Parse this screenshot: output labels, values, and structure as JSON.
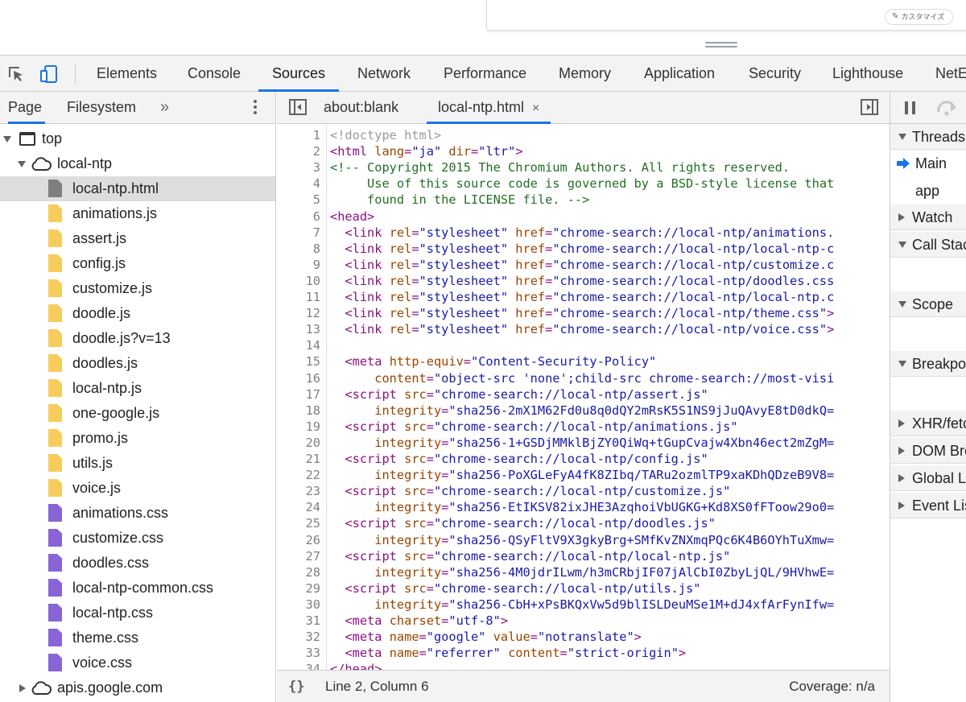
{
  "page": {
    "customize_label": "カスタマイズ"
  },
  "devtools_tabs": [
    "Elements",
    "Console",
    "Sources",
    "Network",
    "Performance",
    "Memory",
    "Application",
    "Security",
    "Lighthouse",
    "NetE"
  ],
  "active_tab": "Sources",
  "navigator": {
    "tabs": [
      "Page",
      "Filesystem"
    ],
    "more": "»",
    "tree": {
      "top": "top",
      "origin": "local-ntp",
      "files": [
        {
          "name": "local-ntp.html",
          "type": "html",
          "selected": true
        },
        {
          "name": "animations.js",
          "type": "js"
        },
        {
          "name": "assert.js",
          "type": "js"
        },
        {
          "name": "config.js",
          "type": "js"
        },
        {
          "name": "customize.js",
          "type": "js"
        },
        {
          "name": "doodle.js",
          "type": "js"
        },
        {
          "name": "doodle.js?v=13",
          "type": "js"
        },
        {
          "name": "doodles.js",
          "type": "js"
        },
        {
          "name": "local-ntp.js",
          "type": "js"
        },
        {
          "name": "one-google.js",
          "type": "js"
        },
        {
          "name": "promo.js",
          "type": "js"
        },
        {
          "name": "utils.js",
          "type": "js"
        },
        {
          "name": "voice.js",
          "type": "js"
        },
        {
          "name": "animations.css",
          "type": "css"
        },
        {
          "name": "customize.css",
          "type": "css"
        },
        {
          "name": "doodles.css",
          "type": "css"
        },
        {
          "name": "local-ntp-common.css",
          "type": "css"
        },
        {
          "name": "local-ntp.css",
          "type": "css"
        },
        {
          "name": "theme.css",
          "type": "css"
        },
        {
          "name": "voice.css",
          "type": "css"
        }
      ],
      "other_origin": "apis.google.com"
    }
  },
  "editor": {
    "tabs": [
      {
        "label": "about:blank",
        "active": false,
        "closable": false
      },
      {
        "label": "local-ntp.html",
        "active": true,
        "closable": true
      }
    ],
    "close_glyph": "×",
    "lines": [
      [
        [
          "doctype",
          "<!doctype html>"
        ]
      ],
      [
        [
          "tag",
          "<html "
        ],
        [
          "attr",
          "lang"
        ],
        [
          "tag",
          "="
        ],
        [
          "val",
          "\"ja\""
        ],
        [
          "tag",
          " "
        ],
        [
          "attr",
          "dir"
        ],
        [
          "tag",
          "="
        ],
        [
          "val",
          "\"ltr\""
        ],
        [
          "tag",
          ">"
        ]
      ],
      [
        [
          "comment",
          "<!-- Copyright 2015 The Chromium Authors. All rights reserved."
        ]
      ],
      [
        [
          "comment",
          "     Use of this source code is governed by a BSD-style license that"
        ]
      ],
      [
        [
          "comment",
          "     found in the LICENSE file. -->"
        ]
      ],
      [
        [
          "tag",
          "<head>"
        ]
      ],
      [
        [
          "tag",
          "  <link "
        ],
        [
          "attr",
          "rel"
        ],
        [
          "tag",
          "="
        ],
        [
          "val",
          "\"stylesheet\""
        ],
        [
          "tag",
          " "
        ],
        [
          "attr",
          "href"
        ],
        [
          "tag",
          "="
        ],
        [
          "val",
          "\"chrome-search://local-ntp/animations."
        ]
      ],
      [
        [
          "tag",
          "  <link "
        ],
        [
          "attr",
          "rel"
        ],
        [
          "tag",
          "="
        ],
        [
          "val",
          "\"stylesheet\""
        ],
        [
          "tag",
          " "
        ],
        [
          "attr",
          "href"
        ],
        [
          "tag",
          "="
        ],
        [
          "val",
          "\"chrome-search://local-ntp/local-ntp-c"
        ]
      ],
      [
        [
          "tag",
          "  <link "
        ],
        [
          "attr",
          "rel"
        ],
        [
          "tag",
          "="
        ],
        [
          "val",
          "\"stylesheet\""
        ],
        [
          "tag",
          " "
        ],
        [
          "attr",
          "href"
        ],
        [
          "tag",
          "="
        ],
        [
          "val",
          "\"chrome-search://local-ntp/customize.c"
        ]
      ],
      [
        [
          "tag",
          "  <link "
        ],
        [
          "attr",
          "rel"
        ],
        [
          "tag",
          "="
        ],
        [
          "val",
          "\"stylesheet\""
        ],
        [
          "tag",
          " "
        ],
        [
          "attr",
          "href"
        ],
        [
          "tag",
          "="
        ],
        [
          "val",
          "\"chrome-search://local-ntp/doodles.css"
        ]
      ],
      [
        [
          "tag",
          "  <link "
        ],
        [
          "attr",
          "rel"
        ],
        [
          "tag",
          "="
        ],
        [
          "val",
          "\"stylesheet\""
        ],
        [
          "tag",
          " "
        ],
        [
          "attr",
          "href"
        ],
        [
          "tag",
          "="
        ],
        [
          "val",
          "\"chrome-search://local-ntp/local-ntp.c"
        ]
      ],
      [
        [
          "tag",
          "  <link "
        ],
        [
          "attr",
          "rel"
        ],
        [
          "tag",
          "="
        ],
        [
          "val",
          "\"stylesheet\""
        ],
        [
          "tag",
          " "
        ],
        [
          "attr",
          "href"
        ],
        [
          "tag",
          "="
        ],
        [
          "val",
          "\"chrome-search://local-ntp/theme.css\""
        ],
        [
          "tag",
          ">"
        ]
      ],
      [
        [
          "tag",
          "  <link "
        ],
        [
          "attr",
          "rel"
        ],
        [
          "tag",
          "="
        ],
        [
          "val",
          "\"stylesheet\""
        ],
        [
          "tag",
          " "
        ],
        [
          "attr",
          "href"
        ],
        [
          "tag",
          "="
        ],
        [
          "val",
          "\"chrome-search://local-ntp/voice.css\""
        ],
        [
          "tag",
          ">"
        ]
      ],
      [],
      [
        [
          "tag",
          "  <meta "
        ],
        [
          "attr",
          "http-equiv"
        ],
        [
          "tag",
          "="
        ],
        [
          "val",
          "\"Content-Security-Policy\""
        ]
      ],
      [
        [
          "tag",
          "      "
        ],
        [
          "attr",
          "content"
        ],
        [
          "tag",
          "="
        ],
        [
          "val",
          "\"object-src 'none';child-src chrome-search://most-visi"
        ]
      ],
      [
        [
          "tag",
          "  <script "
        ],
        [
          "attr",
          "src"
        ],
        [
          "tag",
          "="
        ],
        [
          "val",
          "\"chrome-search://local-ntp/assert.js\""
        ]
      ],
      [
        [
          "tag",
          "      "
        ],
        [
          "attr",
          "integrity"
        ],
        [
          "tag",
          "="
        ],
        [
          "val",
          "\"sha256-2mX1M62Fd0u8q0dQY2mRsK5S1NS9jJuQAvyE8tD0dkQ="
        ]
      ],
      [
        [
          "tag",
          "  <script "
        ],
        [
          "attr",
          "src"
        ],
        [
          "tag",
          "="
        ],
        [
          "val",
          "\"chrome-search://local-ntp/animations.js\""
        ]
      ],
      [
        [
          "tag",
          "      "
        ],
        [
          "attr",
          "integrity"
        ],
        [
          "tag",
          "="
        ],
        [
          "val",
          "\"sha256-1+GSDjMMklBjZY0QiWq+tGupCvajw4Xbn46ect2mZgM="
        ]
      ],
      [
        [
          "tag",
          "  <script "
        ],
        [
          "attr",
          "src"
        ],
        [
          "tag",
          "="
        ],
        [
          "val",
          "\"chrome-search://local-ntp/config.js\""
        ]
      ],
      [
        [
          "tag",
          "      "
        ],
        [
          "attr",
          "integrity"
        ],
        [
          "tag",
          "="
        ],
        [
          "val",
          "\"sha256-PoXGLeFyA4fK8ZIbq/TARu2ozmlTP9xaKDhQDzeB9V8="
        ]
      ],
      [
        [
          "tag",
          "  <script "
        ],
        [
          "attr",
          "src"
        ],
        [
          "tag",
          "="
        ],
        [
          "val",
          "\"chrome-search://local-ntp/customize.js\""
        ]
      ],
      [
        [
          "tag",
          "      "
        ],
        [
          "attr",
          "integrity"
        ],
        [
          "tag",
          "="
        ],
        [
          "val",
          "\"sha256-EtIKSV82ixJHE3AzqhoiVbUGKG+Kd8XS0fFToow29o0="
        ]
      ],
      [
        [
          "tag",
          "  <script "
        ],
        [
          "attr",
          "src"
        ],
        [
          "tag",
          "="
        ],
        [
          "val",
          "\"chrome-search://local-ntp/doodles.js\""
        ]
      ],
      [
        [
          "tag",
          "      "
        ],
        [
          "attr",
          "integrity"
        ],
        [
          "tag",
          "="
        ],
        [
          "val",
          "\"sha256-QSyFltV9X3gkyBrg+SMfKvZNXmqPQc6K4B6OYhTuXmw="
        ]
      ],
      [
        [
          "tag",
          "  <script "
        ],
        [
          "attr",
          "src"
        ],
        [
          "tag",
          "="
        ],
        [
          "val",
          "\"chrome-search://local-ntp/local-ntp.js\""
        ]
      ],
      [
        [
          "tag",
          "      "
        ],
        [
          "attr",
          "integrity"
        ],
        [
          "tag",
          "="
        ],
        [
          "val",
          "\"sha256-4M0jdrILwm/h3mCRbjIF07jAlCbI0ZbyLjQL/9HVhwE="
        ]
      ],
      [
        [
          "tag",
          "  <script "
        ],
        [
          "attr",
          "src"
        ],
        [
          "tag",
          "="
        ],
        [
          "val",
          "\"chrome-search://local-ntp/utils.js\""
        ]
      ],
      [
        [
          "tag",
          "      "
        ],
        [
          "attr",
          "integrity"
        ],
        [
          "tag",
          "="
        ],
        [
          "val",
          "\"sha256-CbH+xPsBKQxVw5d9blISLDeuMSe1M+dJ4xfArFynIfw="
        ]
      ],
      [
        [
          "tag",
          "  <meta "
        ],
        [
          "attr",
          "charset"
        ],
        [
          "tag",
          "="
        ],
        [
          "val",
          "\"utf-8\""
        ],
        [
          "tag",
          ">"
        ]
      ],
      [
        [
          "tag",
          "  <meta "
        ],
        [
          "attr",
          "name"
        ],
        [
          "tag",
          "="
        ],
        [
          "val",
          "\"google\""
        ],
        [
          "tag",
          " "
        ],
        [
          "attr",
          "value"
        ],
        [
          "tag",
          "="
        ],
        [
          "val",
          "\"notranslate\""
        ],
        [
          "tag",
          ">"
        ]
      ],
      [
        [
          "tag",
          "  <meta "
        ],
        [
          "attr",
          "name"
        ],
        [
          "tag",
          "="
        ],
        [
          "val",
          "\"referrer\""
        ],
        [
          "tag",
          " "
        ],
        [
          "attr",
          "content"
        ],
        [
          "tag",
          "="
        ],
        [
          "val",
          "\"strict-origin\""
        ],
        [
          "tag",
          ">"
        ]
      ],
      [
        [
          "tag",
          "</head>"
        ]
      ]
    ],
    "status": {
      "pretty_print": "{}",
      "cursor": "Line 2, Column 6",
      "coverage": "Coverage: n/a"
    }
  },
  "debugger": {
    "threads_label": "Threads",
    "threads": [
      "Main",
      "app"
    ],
    "sections": [
      "Watch",
      "Call Stack",
      "Scope",
      "Breakpoints",
      "XHR/fetch Breakpoints",
      "DOM Breakpoints",
      "Global Listeners",
      "Event Listener Breakpoints"
    ]
  },
  "colors": {
    "accent": "#1a73e8",
    "tag": "#881280",
    "attr": "#994500",
    "value": "#1a1aa6",
    "comment": "#236e25"
  }
}
